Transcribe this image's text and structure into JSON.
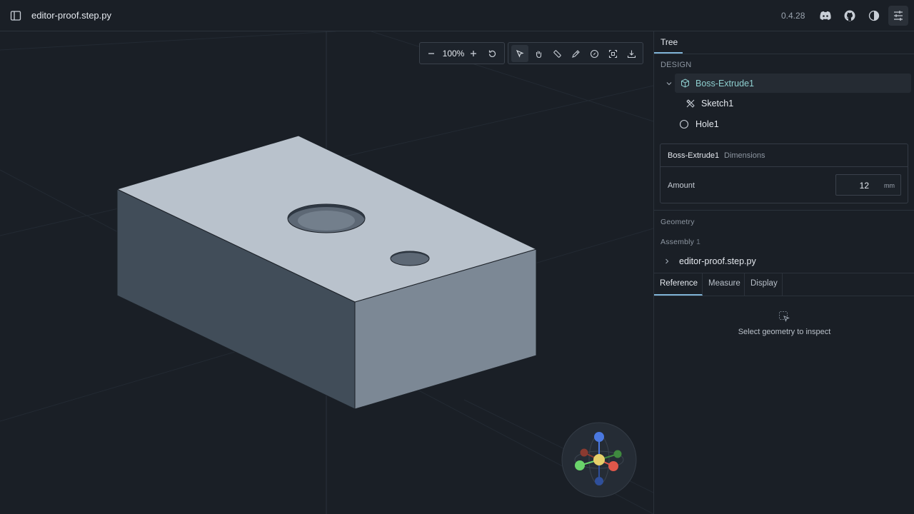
{
  "header": {
    "filename": "editor-proof.step.py",
    "version": "0.4.28",
    "icons": [
      "sidebar-toggle-icon",
      "discord-icon",
      "github-icon",
      "contrast-icon",
      "sliders-icon"
    ]
  },
  "toolbar": {
    "zoom_level": "100%",
    "tools": [
      "select-icon",
      "pan-hand-icon",
      "measure-ruler-icon",
      "annotate-pen-icon",
      "compass-icon",
      "fit-view-icon",
      "download-icon"
    ]
  },
  "panel": {
    "tab": "Tree",
    "design_label": "DESIGN",
    "tree": [
      {
        "label": "Boss-Extrude1",
        "icon": "cube-icon",
        "selected": true
      },
      {
        "label": "Sketch1",
        "icon": "sketch-icon"
      },
      {
        "label": "Hole1",
        "icon": "circle-icon"
      }
    ],
    "dimensions": {
      "title": "Boss-Extrude1",
      "subtitle": "Dimensions",
      "amount_label": "Amount",
      "amount_value": "12",
      "unit": "mm"
    },
    "geometry_label": "Geometry",
    "assembly_label": "Assembly",
    "assembly_count": "1",
    "assembly_item": "editor-proof.step.py",
    "bottom_tabs": [
      "Reference",
      "Measure",
      "Display"
    ],
    "empty_text": "Select geometry to inspect"
  },
  "colors": {
    "background": "#1a1f26",
    "accent": "#7fb3d6",
    "selected_text": "#8ecfd0",
    "part_top": "#b9c2cc",
    "part_left": "#414d59",
    "part_right": "#7c8895"
  }
}
